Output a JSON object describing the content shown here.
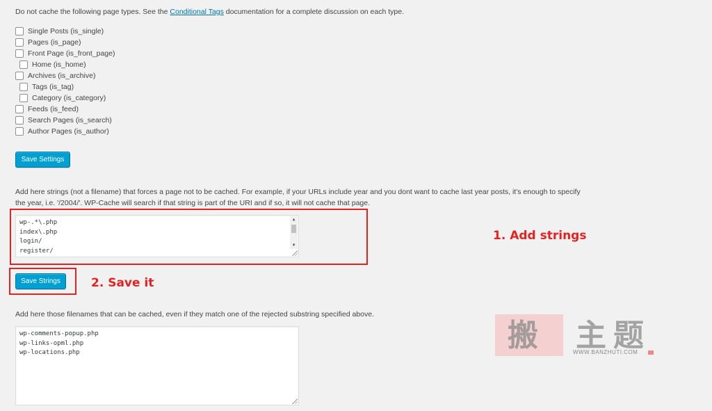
{
  "intro": {
    "before": "Do not cache the following page types. See the ",
    "link": "Conditional Tags",
    "after": " documentation for a complete discussion on each type."
  },
  "page_types": [
    {
      "label": "Single Posts (is_single)",
      "checked": false
    },
    {
      "label": "Pages (is_page)",
      "checked": false
    },
    {
      "label": "Front Page (is_front_page)",
      "checked": false
    },
    {
      "label": "Home (is_home)",
      "checked": false
    },
    {
      "label": "Archives (is_archive)",
      "checked": false
    },
    {
      "label": "Tags (is_tag)",
      "checked": false
    },
    {
      "label": "Category (is_category)",
      "checked": false
    },
    {
      "label": "Feeds (is_feed)",
      "checked": false
    },
    {
      "label": "Search Pages (is_search)",
      "checked": false
    },
    {
      "label": "Author Pages (is_author)",
      "checked": false
    }
  ],
  "save_settings_label": "Save Settings",
  "rejected": {
    "description": "Add here strings (not a filename) that forces a page not to be cached. For example, if your URLs include year and you dont want to cache last year posts, it's enough to specify the year, i.e. '/2004/'. WP-Cache will search if that string is part of the URI and if so, it will not cache that page.",
    "lines": [
      "wp-.*\\.php",
      "index\\.php",
      "login/",
      "register/"
    ],
    "save_label": "Save Strings"
  },
  "accepted": {
    "description": "Add here those filenames that can be cached, even if they match one of the rejected substring specified above.",
    "lines": [
      "wp-comments-popup.php",
      "wp-links-opml.php",
      "wp-locations.php"
    ]
  },
  "annotations": {
    "step1": "1. Add strings",
    "step2": "2. Save it",
    "color": "#e52222"
  },
  "watermark": {
    "chars": [
      "搬",
      "主",
      "题"
    ],
    "url": "WWW.BANZHUTI.COM"
  },
  "colors": {
    "button": "#00a0d2",
    "link": "#0073aa",
    "background": "#f1f1f1"
  }
}
